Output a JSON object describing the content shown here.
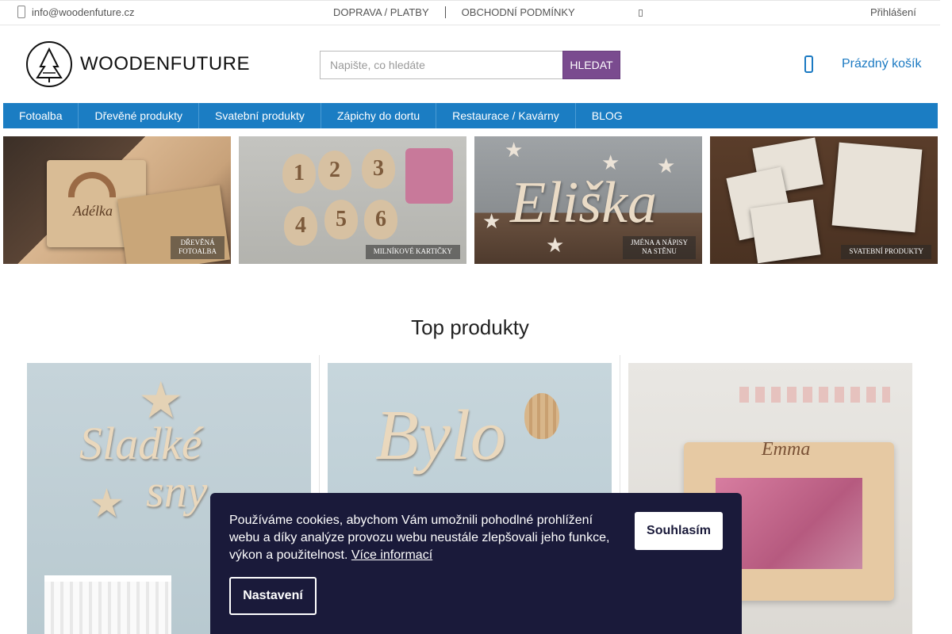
{
  "topbar": {
    "email": "info@woodenfuture.cz",
    "links": [
      "DOPRAVA / PLATBY",
      "OBCHODNÍ PODMÍNKY"
    ],
    "login": "Přihlášení"
  },
  "header": {
    "logo_text": "WOODENFUTURE",
    "search_placeholder": "Napište, co hledáte",
    "search_button": "HLEDAT",
    "cart_label": "Prázdný košík"
  },
  "nav": {
    "items": [
      "Fotoalba",
      "Dřevěné produkty",
      "Svatební produkty",
      "Zápichy do dortu",
      "Restaurace / Kavárny",
      "BLOG"
    ]
  },
  "banners": [
    {
      "caption_line1": "DŘEVĚNÁ",
      "caption_line2": "FOTOALBA",
      "art_text": "Adélka"
    },
    {
      "caption_line1": "MILNÍKOVÉ KARTIČKY",
      "caption_line2": "",
      "numbers": [
        "1",
        "2",
        "3",
        "4",
        "5",
        "6"
      ]
    },
    {
      "caption_line1": "JMÉNA A NÁPISY",
      "caption_line2": "NA STĚNU",
      "art_text": "Eliška"
    },
    {
      "caption_line1": "SVATEBNÍ PRODUKTY",
      "caption_line2": ""
    }
  ],
  "section": {
    "title": "Top produkty"
  },
  "products": [
    {
      "art_line1": "Sladké",
      "art_line2": "sny"
    },
    {
      "art_line1": "Bylo"
    },
    {
      "art_name": "Emma"
    }
  ],
  "cookie": {
    "message": "Používáme cookies, abychom Vám umožnili pohodlné prohlížení webu a díky analýze provozu webu neustále zlepšovali jeho funkce, výkon a použitelnost.",
    "more_link": "Více informací",
    "accept": "Souhlasím",
    "settings": "Nastavení"
  },
  "colors": {
    "nav_bg": "#1b7dc3",
    "search_button_bg": "#7a4b8f",
    "cart_text": "#1a79c2",
    "cookie_bg": "#1a1a3a"
  }
}
